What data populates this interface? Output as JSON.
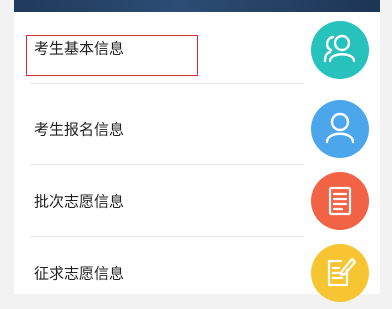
{
  "menu": {
    "items": [
      {
        "label": "考生基本信息",
        "icon": "users-icon",
        "color": "#26c2bb"
      },
      {
        "label": "考生报名信息",
        "icon": "user-icon",
        "color": "#4ba6ec"
      },
      {
        "label": "批次志愿信息",
        "icon": "document-list-icon",
        "color": "#f26244"
      },
      {
        "label": "征求志愿信息",
        "icon": "edit-note-icon",
        "color": "#f7c531"
      }
    ]
  },
  "colors": {
    "highlight_border": "#c8303a",
    "header_bar": "#1f3a5c"
  }
}
